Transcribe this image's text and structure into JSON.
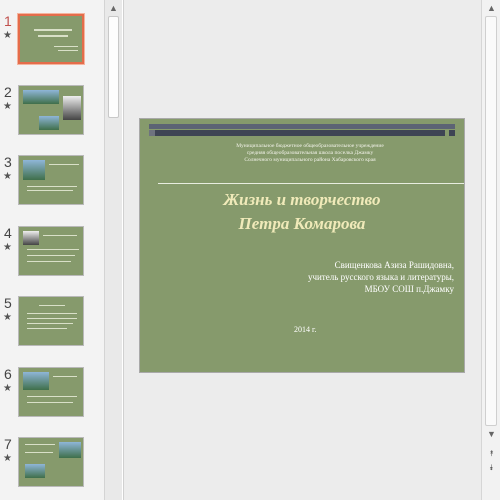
{
  "thumbnails": [
    {
      "number": "1",
      "star": "★",
      "active": true
    },
    {
      "number": "2",
      "star": "★",
      "active": false
    },
    {
      "number": "3",
      "star": "★",
      "active": false
    },
    {
      "number": "4",
      "star": "★",
      "active": false
    },
    {
      "number": "5",
      "star": "★",
      "active": false
    },
    {
      "number": "6",
      "star": "★",
      "active": false
    },
    {
      "number": "7",
      "star": "★",
      "active": false
    }
  ],
  "scroll": {
    "up": "▲",
    "down": "▼",
    "prev_slide": "⯭",
    "next_slide": "⯯"
  },
  "slide": {
    "institution_line1": "Муниципальное бюджетное общеобразовательное учреждение",
    "institution_line2": "средняя общеобразовательная школа поселка Джамку",
    "institution_line3": "Солнечного муниципального района Хабаровского края",
    "title_line1": "Жизнь и творчество",
    "title_line2": "Петра Комарова",
    "author_line1": "Свищенкова Азиза Рашидовна,",
    "author_line2": "учитель русского языка и литературы,",
    "author_line3": "МБОУ СОШ п.Джамку",
    "year": "2014 г."
  },
  "colors": {
    "slide_background": "#869a6c",
    "title_color": "#f0eab9",
    "active_thumbnail_border": "#e46c4a"
  }
}
